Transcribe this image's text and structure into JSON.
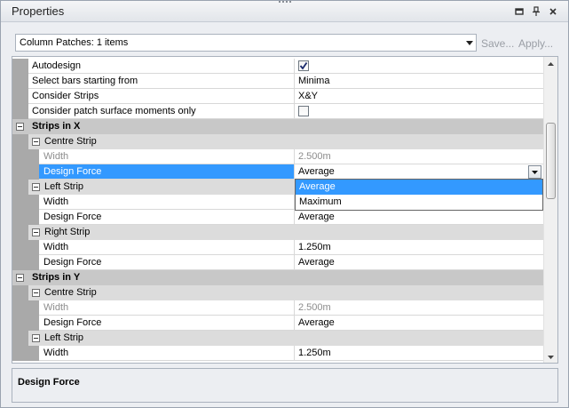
{
  "window": {
    "title": "Properties"
  },
  "titlebar_buttons": [
    {
      "icon": "dropdown-menu-icon"
    },
    {
      "icon": "pin-icon"
    },
    {
      "icon": "close-icon"
    }
  ],
  "selector": {
    "value": "Column Patches: 1 items",
    "save_label": "Save...",
    "apply_label": "Apply..."
  },
  "rows": [
    {
      "kind": "prop",
      "level": 0,
      "name": "Autodesign",
      "value": "",
      "checkbox": true,
      "checked": true
    },
    {
      "kind": "prop",
      "level": 0,
      "name": "Select bars starting from",
      "value": "Minima"
    },
    {
      "kind": "prop",
      "level": 0,
      "name": "Consider Strips",
      "value": "X&Y"
    },
    {
      "kind": "prop",
      "level": 0,
      "name": "Consider patch surface moments only",
      "value": "",
      "checkbox": true,
      "checked": false
    },
    {
      "kind": "cat",
      "name": "Strips in X"
    },
    {
      "kind": "subcat",
      "name": "Centre Strip"
    },
    {
      "kind": "prop",
      "level": 1,
      "name": "Width",
      "value": "2.500m",
      "dim": true
    },
    {
      "kind": "prop",
      "level": 1,
      "name": "Design Force",
      "value": "Average",
      "selected": true
    },
    {
      "kind": "subcat",
      "name": "Left Strip"
    },
    {
      "kind": "prop",
      "level": 1,
      "name": "Width",
      "value": ""
    },
    {
      "kind": "prop",
      "level": 1,
      "name": "Design Force",
      "value": "Average"
    },
    {
      "kind": "subcat",
      "name": "Right Strip"
    },
    {
      "kind": "prop",
      "level": 1,
      "name": "Width",
      "value": "1.250m"
    },
    {
      "kind": "prop",
      "level": 1,
      "name": "Design Force",
      "value": "Average"
    },
    {
      "kind": "cat",
      "name": "Strips in Y"
    },
    {
      "kind": "subcat",
      "name": "Centre Strip"
    },
    {
      "kind": "prop",
      "level": 1,
      "name": "Width",
      "value": "2.500m",
      "dim": true
    },
    {
      "kind": "prop",
      "level": 1,
      "name": "Design Force",
      "value": "Average"
    },
    {
      "kind": "subcat",
      "name": "Left Strip"
    },
    {
      "kind": "prop",
      "level": 1,
      "name": "Width",
      "value": "1.250m"
    }
  ],
  "dropdown": {
    "options": [
      "Average",
      "Maximum"
    ],
    "highlighted": "Average"
  },
  "description": {
    "title": "Design Force"
  },
  "colors": {
    "selection": "#3399ff",
    "category_bg": "#c8c8c8",
    "subcategory_bg": "#dcdcdc",
    "gutter": "#a9a9a9"
  }
}
